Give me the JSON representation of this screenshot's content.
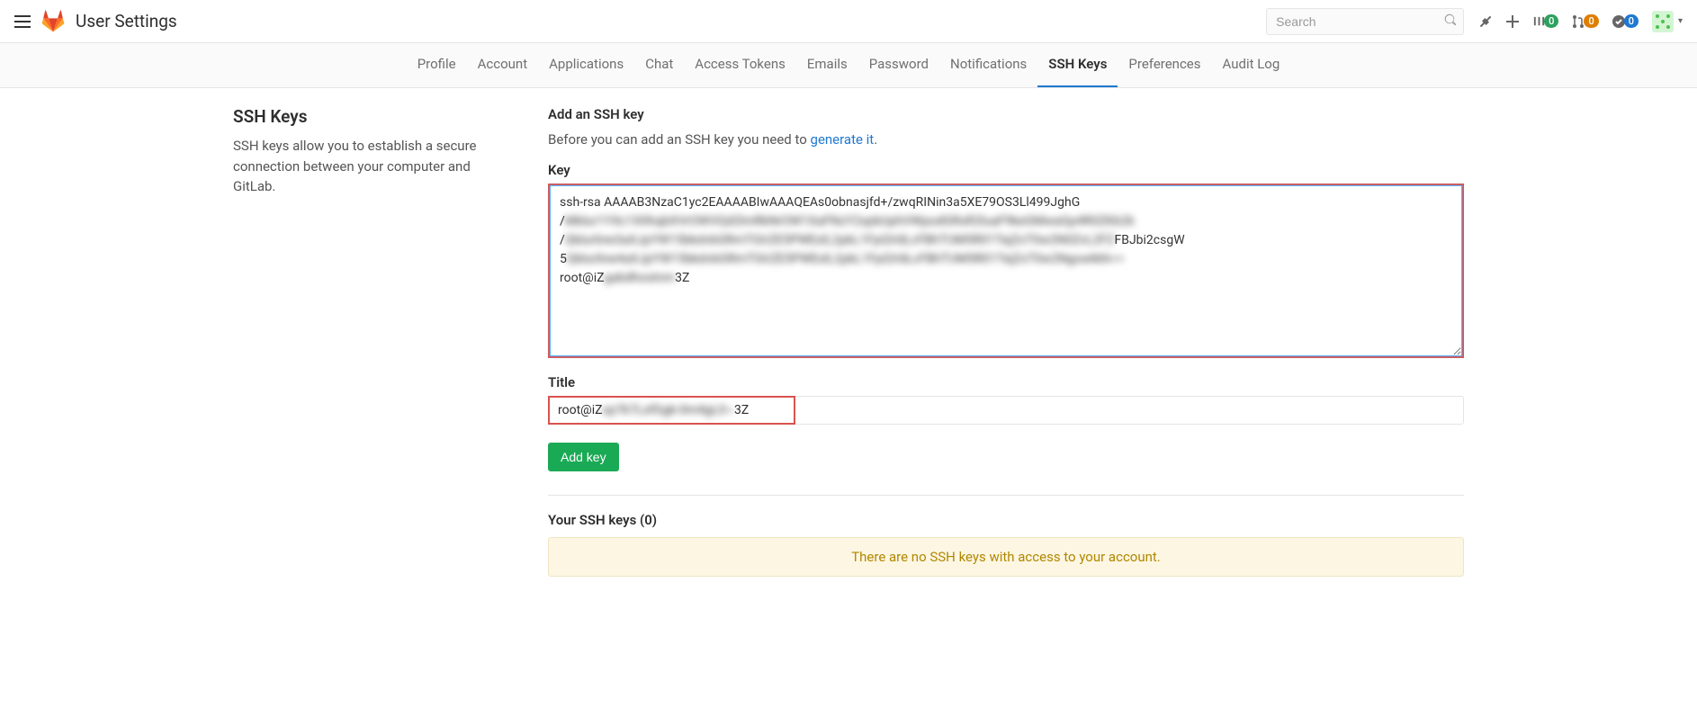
{
  "header": {
    "title": "User Settings",
    "search_placeholder": "Search"
  },
  "badges": {
    "issues": "0",
    "merge": "0",
    "todos": "0"
  },
  "tabs": [
    {
      "label": "Profile",
      "active": false
    },
    {
      "label": "Account",
      "active": false
    },
    {
      "label": "Applications",
      "active": false
    },
    {
      "label": "Chat",
      "active": false
    },
    {
      "label": "Access Tokens",
      "active": false
    },
    {
      "label": "Emails",
      "active": false
    },
    {
      "label": "Password",
      "active": false
    },
    {
      "label": "Notifications",
      "active": false
    },
    {
      "label": "SSH Keys",
      "active": true
    },
    {
      "label": "Preferences",
      "active": false
    },
    {
      "label": "Audit Log",
      "active": false
    }
  ],
  "sidebar": {
    "title": "SSH Keys",
    "desc": "SSH keys allow you to establish a secure connection between your computer and GitLab."
  },
  "form": {
    "add_title": "Add an SSH key",
    "before_text": "Before you can add an SSH key you need to ",
    "generate_link": "generate it",
    "period": ".",
    "key_label": "Key",
    "key_line1": "ssh-rsa AAAAB3NzaC1yc2EAAAABIwAAAQEAs0obnasjfd+/zwqRINin3a5XE79OS3Ll499JghG",
    "key_line2_start": "/",
    "key_line2_blur": "Mblur1YXc1X0hqbXVrOWVQd2lmRkNrOW1XaFNzY2xpbUphVWpodGRsR2luaF9keGMwaGp4R0ZKb2k",
    "key_line3_start": "/",
    "key_line3_blur": "Qblurline3aXJpYW15bkdvbGRmTGIrZE5PWExlL2pkL1FpQVdLcFBhTUM5R01TejZxT0w2N0ZvL2FZ",
    "key_line3_end": "FBJbi2csgW",
    "key_line4_start": "5",
    "key_line4_blur": "Qblurline4aXJpYW15bkdvbGRmTGIrZE5PWExlL2pkL1FpQVdLcFBhTUM5R01TejZxT0w2NgowMA==",
    "key_line5_start": "root@iZ",
    "key_line5_blur": "gabdhostnm",
    "key_line5_end": "3Z",
    "title_label": "Title",
    "title_start": "root@iZ",
    "title_blur": "xp7k7LsfGgk-0m4gL0~",
    "title_end": "3Z",
    "add_button": "Add key"
  },
  "list": {
    "title": "Your SSH keys (0)",
    "empty": "There are no SSH keys with access to your account."
  }
}
